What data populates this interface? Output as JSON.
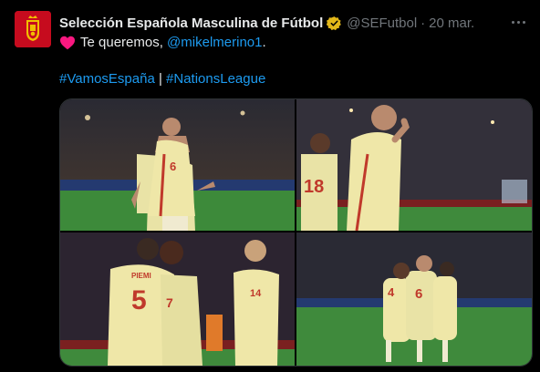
{
  "tweet": {
    "display_name": "Selección Española Masculina de Fútbol",
    "handle": "@SEFutbol",
    "separator": "·",
    "date": "20 mar.",
    "text_before_mention": "Te queremos, ",
    "mention": "@mikelmerino1",
    "text_after_mention": ".",
    "hashtag_1": "#VamosEspaña",
    "hashtag_separator": " | ",
    "hashtag_2": "#NationsLeague"
  },
  "photos": [
    {
      "jersey_number": "6"
    },
    {
      "jersey_number": "18"
    },
    {
      "jersey_numbers": [
        "5",
        "7",
        "14"
      ],
      "name_fragment": "PIEMI"
    },
    {
      "jersey_numbers": [
        "4",
        "6"
      ]
    }
  ],
  "icons": {
    "avatar": "spain-crest-icon",
    "verified": "gold-verified-badge-icon",
    "heart": "red-heart-emoji-icon",
    "more": "more-options-icon"
  },
  "colors": {
    "background": "#000000",
    "primary_text": "#e7e9ea",
    "secondary_text": "#71767b",
    "link": "#1d9bf0",
    "verified_badge": "#e2b719",
    "heart": "#f91880",
    "avatar_red": "#c60b1e"
  }
}
